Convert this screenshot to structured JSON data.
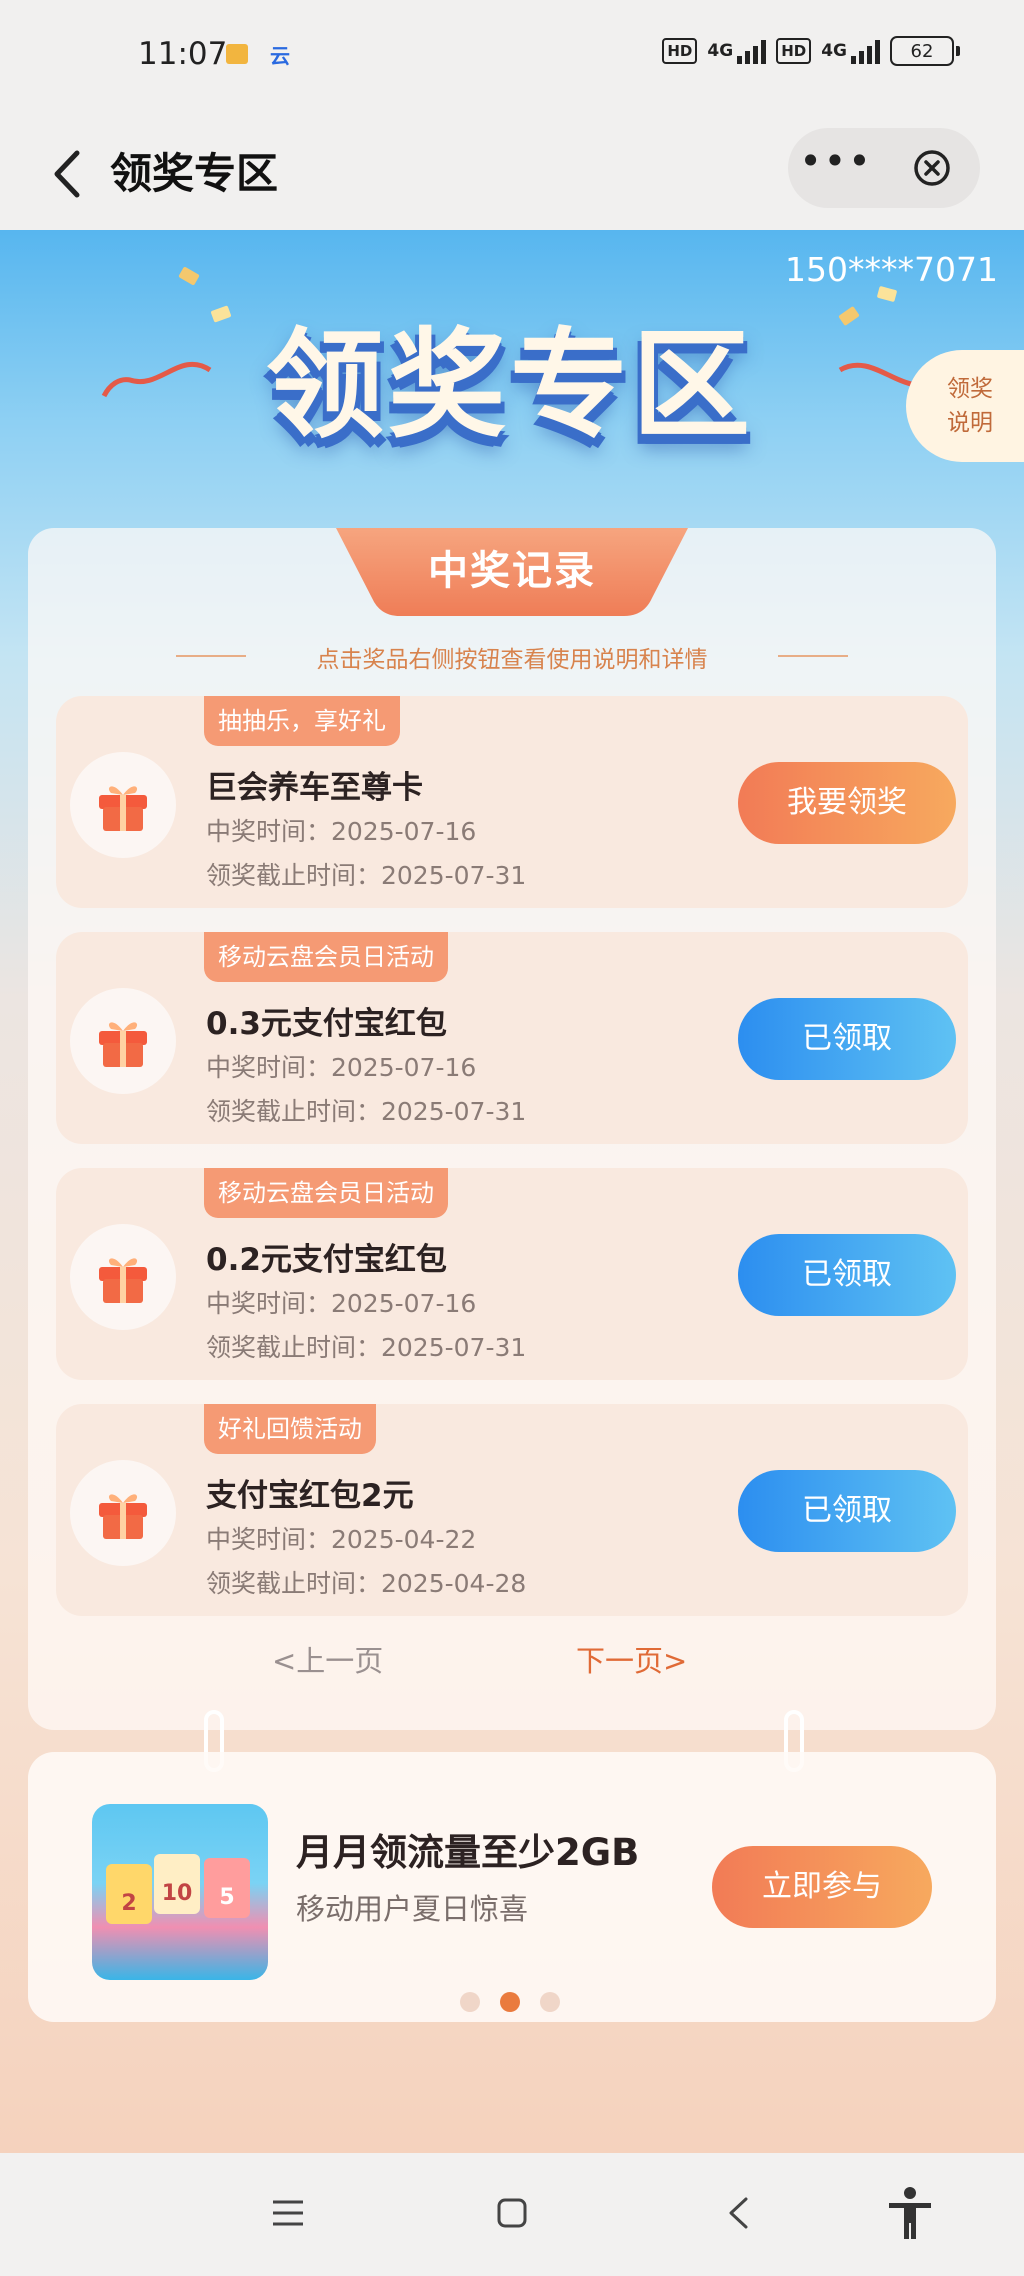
{
  "status_bar": {
    "time": "11:07",
    "cloud_label": "云",
    "hd1": "HD",
    "net1": "4G",
    "hd2": "HD",
    "net2": "4G",
    "battery": "62"
  },
  "header": {
    "title": "领奖专区"
  },
  "banner": {
    "phone": "150****7071",
    "title": "领奖专区",
    "rules_label": "领奖说明"
  },
  "records": {
    "section_title": "中奖记录",
    "hint": "点击奖品右侧按钮查看使用说明和详情",
    "items": [
      {
        "tag": "抽抽乐，享好礼",
        "name": "巨会养车至尊卡",
        "win_date": "中奖时间：2025-07-16",
        "deadline": "领奖截止时间：2025-07-31",
        "action": "我要领奖",
        "status": "claimable"
      },
      {
        "tag": "移动云盘会员日活动",
        "name": "0.3元支付宝红包",
        "win_date": "中奖时间：2025-07-16",
        "deadline": "领奖截止时间：2025-07-31",
        "action": "已领取",
        "status": "claimed"
      },
      {
        "tag": "移动云盘会员日活动",
        "name": "0.2元支付宝红包",
        "win_date": "中奖时间：2025-07-16",
        "deadline": "领奖截止时间：2025-07-31",
        "action": "已领取",
        "status": "claimed"
      },
      {
        "tag": "好礼回馈活动",
        "name": "支付宝红包2元",
        "win_date": "中奖时间：2025-04-22",
        "deadline": "领奖截止时间：2025-04-28",
        "action": "已领取",
        "status": "claimed"
      }
    ],
    "prev_page": "<上一页",
    "next_page": "下一页>"
  },
  "promo": {
    "title": "月月领流量至少2GB",
    "subtitle": "移动用户夏日惊喜",
    "button": "立即参与",
    "thumb_values": [
      "2",
      "10",
      "5"
    ],
    "dots_count": 3,
    "active_dot": 2
  },
  "colors": {
    "accent_orange": "#f27b56",
    "accent_blue": "#2c8ef0",
    "tag_orange": "#f59a74"
  },
  "icons": {
    "back": "chevron-left-icon",
    "more": "more-dots-icon",
    "close": "close-circle-icon",
    "gift": "gift-icon",
    "nav_menu": "menu-icon",
    "nav_home": "home-square-icon",
    "nav_back": "back-triangle-icon",
    "nav_access": "accessibility-icon"
  }
}
